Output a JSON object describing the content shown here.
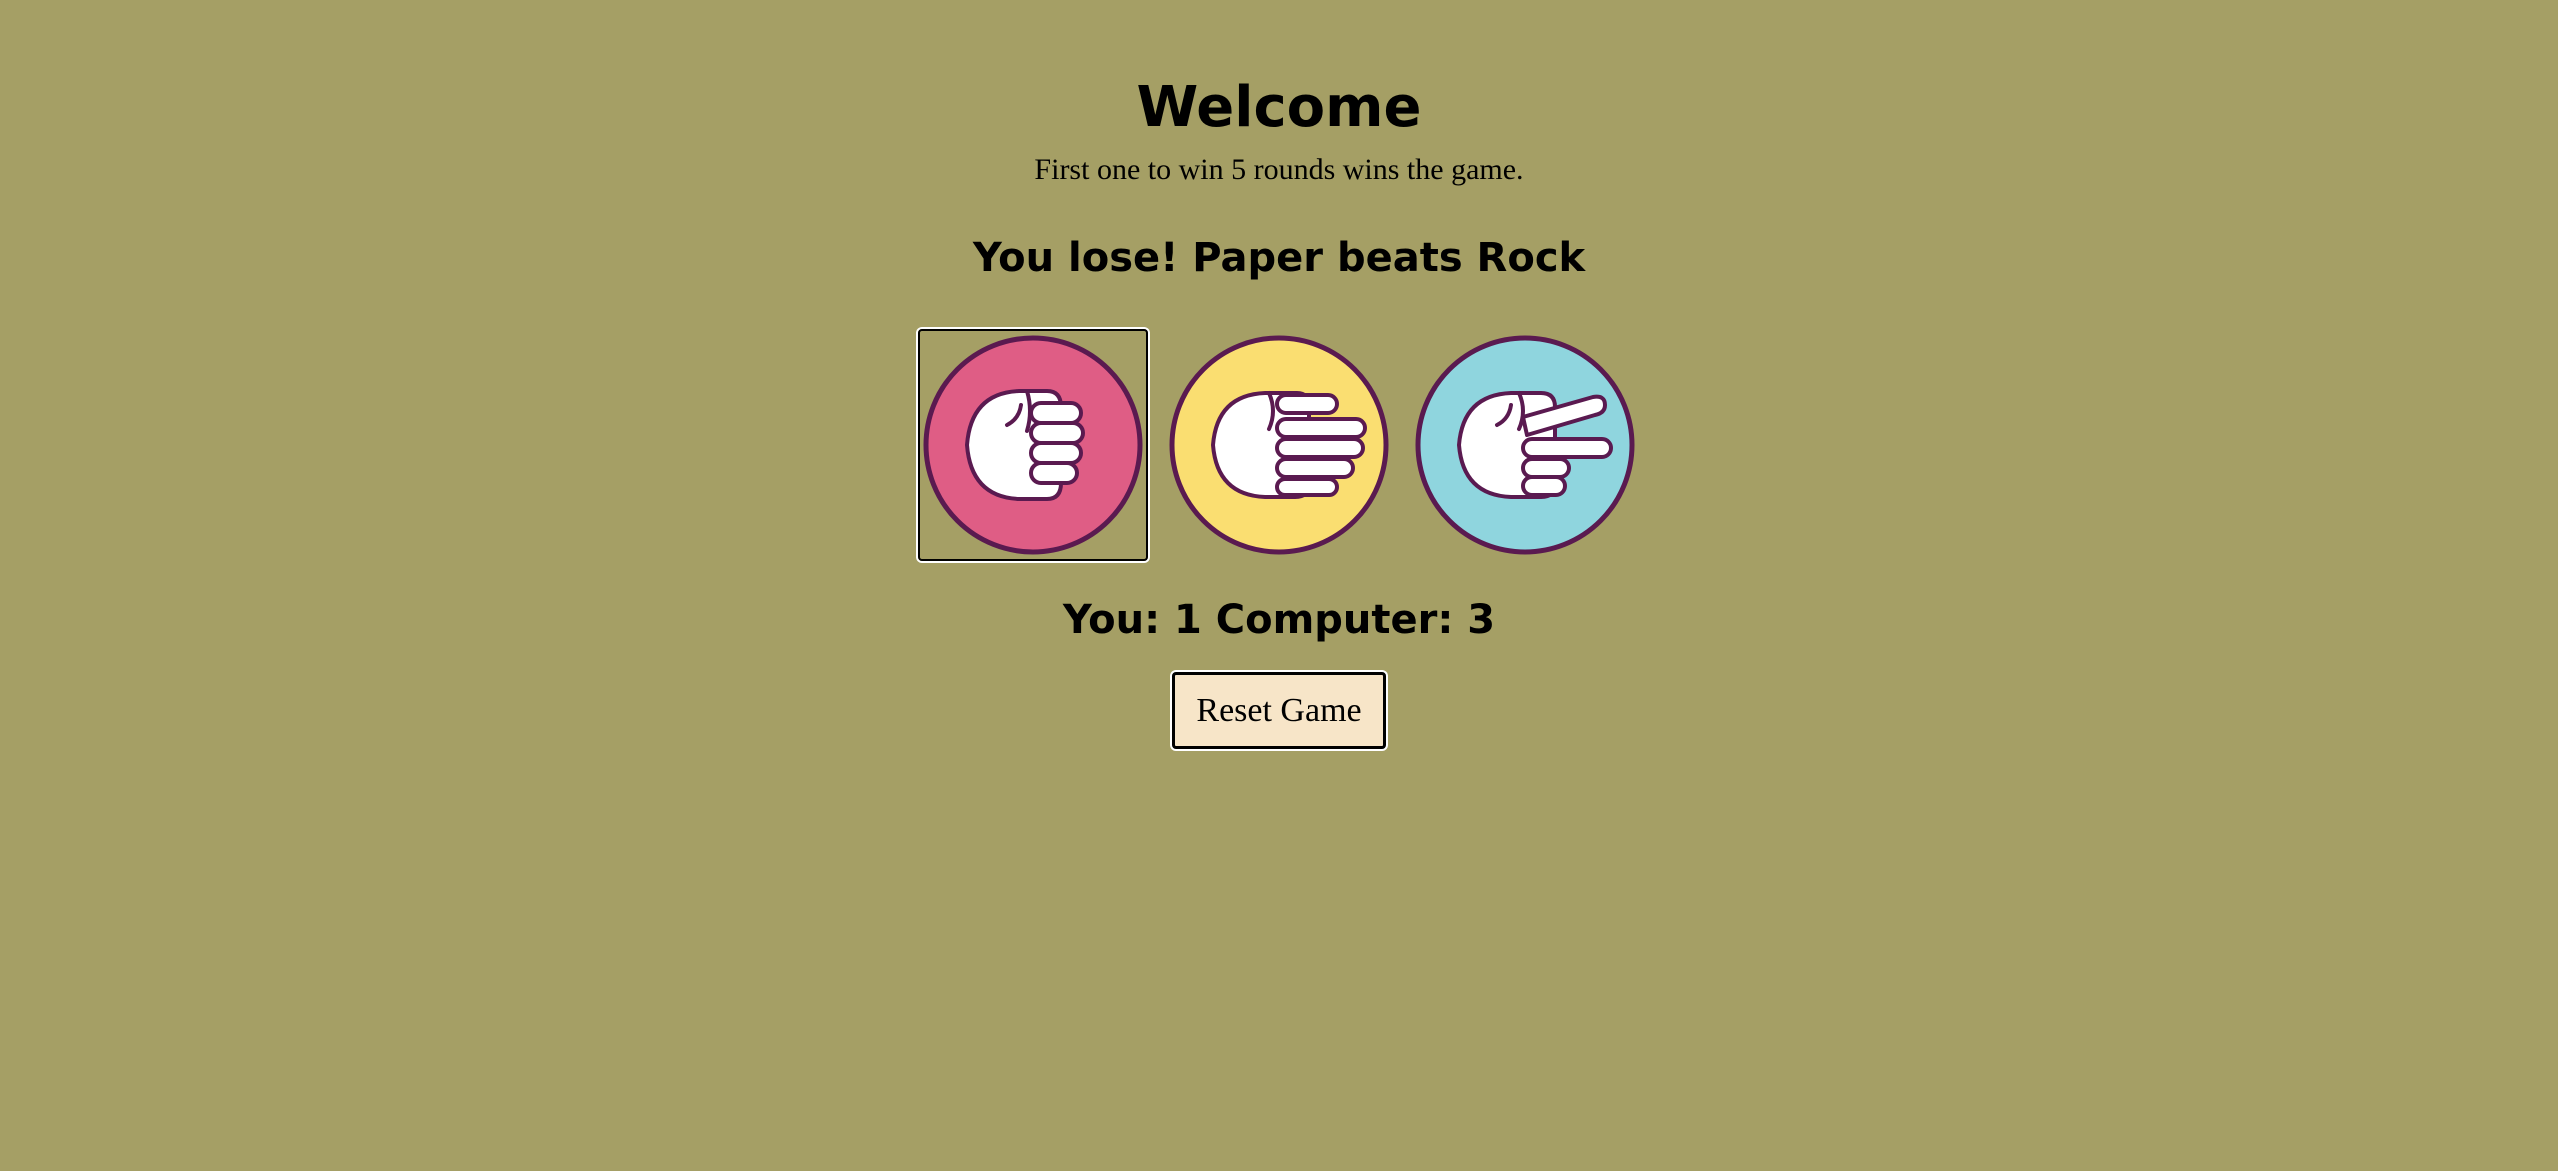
{
  "header": {
    "title": "Welcome",
    "subtitle": "First one to win 5 rounds wins the game."
  },
  "round": {
    "result_text": "You lose! Paper beats Rock"
  },
  "choices": [
    {
      "name": "rock",
      "icon": "rock-hand-icon",
      "color": "#df5d85",
      "selected": true
    },
    {
      "name": "paper",
      "icon": "paper-hand-icon",
      "color": "#fade71",
      "selected": false
    },
    {
      "name": "scissors",
      "icon": "scissors-hand-icon",
      "color": "#8fd5de",
      "selected": false
    }
  ],
  "score": {
    "text": "You: 1 Computer: 3"
  },
  "controls": {
    "reset_label": "Reset Game"
  },
  "colors": {
    "background": "#a59f65",
    "outline": "#5a1a50",
    "button_bg": "#f7e5c8"
  }
}
